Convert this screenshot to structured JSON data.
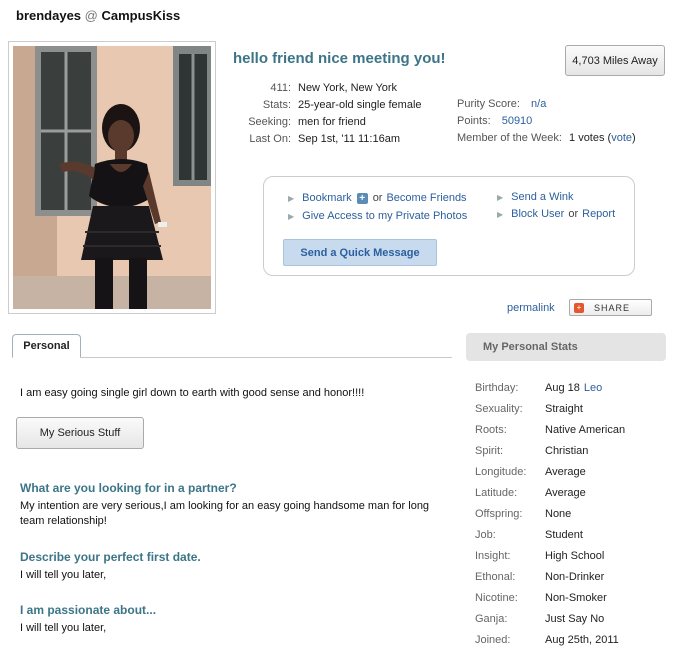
{
  "header": {
    "username": "brendayes",
    "at": "@",
    "site": "CampusKiss"
  },
  "headline": "hello friend nice meeting you!",
  "distance": "4,703 Miles Away",
  "info": [
    {
      "label": "411:",
      "value": "New York, New York"
    },
    {
      "label": "Stats:",
      "value": "25-year-old single female"
    },
    {
      "label": "Seeking:",
      "value": "men for friend"
    },
    {
      "label": "Last On:",
      "value": "Sep 1st, '11 11:16am"
    }
  ],
  "purity": {
    "label": "Purity Score:",
    "value": "n/a"
  },
  "points": {
    "label": "Points:",
    "value": "50910"
  },
  "motw": {
    "label": "Member of the Week:",
    "value": "1 votes (",
    "link": "vote",
    "close": ")"
  },
  "actions": {
    "bookmark": "Bookmark",
    "plus": "+",
    "or1": "or",
    "become_friends": "Become Friends",
    "give_access": "Give Access to my Private Photos",
    "send_wink": "Send a Wink",
    "block_user": "Block User",
    "or2": "or",
    "report": "Report",
    "quick_message": "Send a Quick Message"
  },
  "permalink": "permalink",
  "share": "SHARE",
  "share_glyph": "+",
  "tab": "Personal",
  "about": "I am easy going single girl down to earth with good sense and honor!!!!",
  "serious_button": "My Serious Stuff",
  "qa": [
    {
      "q": "What are you looking for in a partner?",
      "a": "My intention are very serious,I am looking for an easy going handsome man for long team relationship!"
    },
    {
      "q": "Describe your perfect first date.",
      "a": "I will tell you later,"
    },
    {
      "q": "I am passionate about...",
      "a": "I will tell you later,"
    }
  ],
  "stats_title": "My Personal Stats",
  "stats": [
    {
      "k": "Birthday:",
      "v": "Aug 18",
      "extra": "Leo"
    },
    {
      "k": "Sexuality:",
      "v": "Straight"
    },
    {
      "k": "Roots:",
      "v": "Native American"
    },
    {
      "k": "Spirit:",
      "v": "Christian"
    },
    {
      "k": "Longitude:",
      "v": "Average"
    },
    {
      "k": "Latitude:",
      "v": "Average"
    },
    {
      "k": "Offspring:",
      "v": "None"
    },
    {
      "k": "Job:",
      "v": "Student"
    },
    {
      "k": "Insight:",
      "v": "High School"
    },
    {
      "k": "Ethonal:",
      "v": "Non-Drinker"
    },
    {
      "k": "Nicotine:",
      "v": "Non-Smoker"
    },
    {
      "k": "Ganja:",
      "v": "Just Say No"
    },
    {
      "k": "Joined:",
      "v": "Aug 25th, 2011"
    }
  ],
  "colors": {
    "accent": "#3b7587",
    "link": "#2b5f9e",
    "button_blue": "#c8dbee"
  }
}
